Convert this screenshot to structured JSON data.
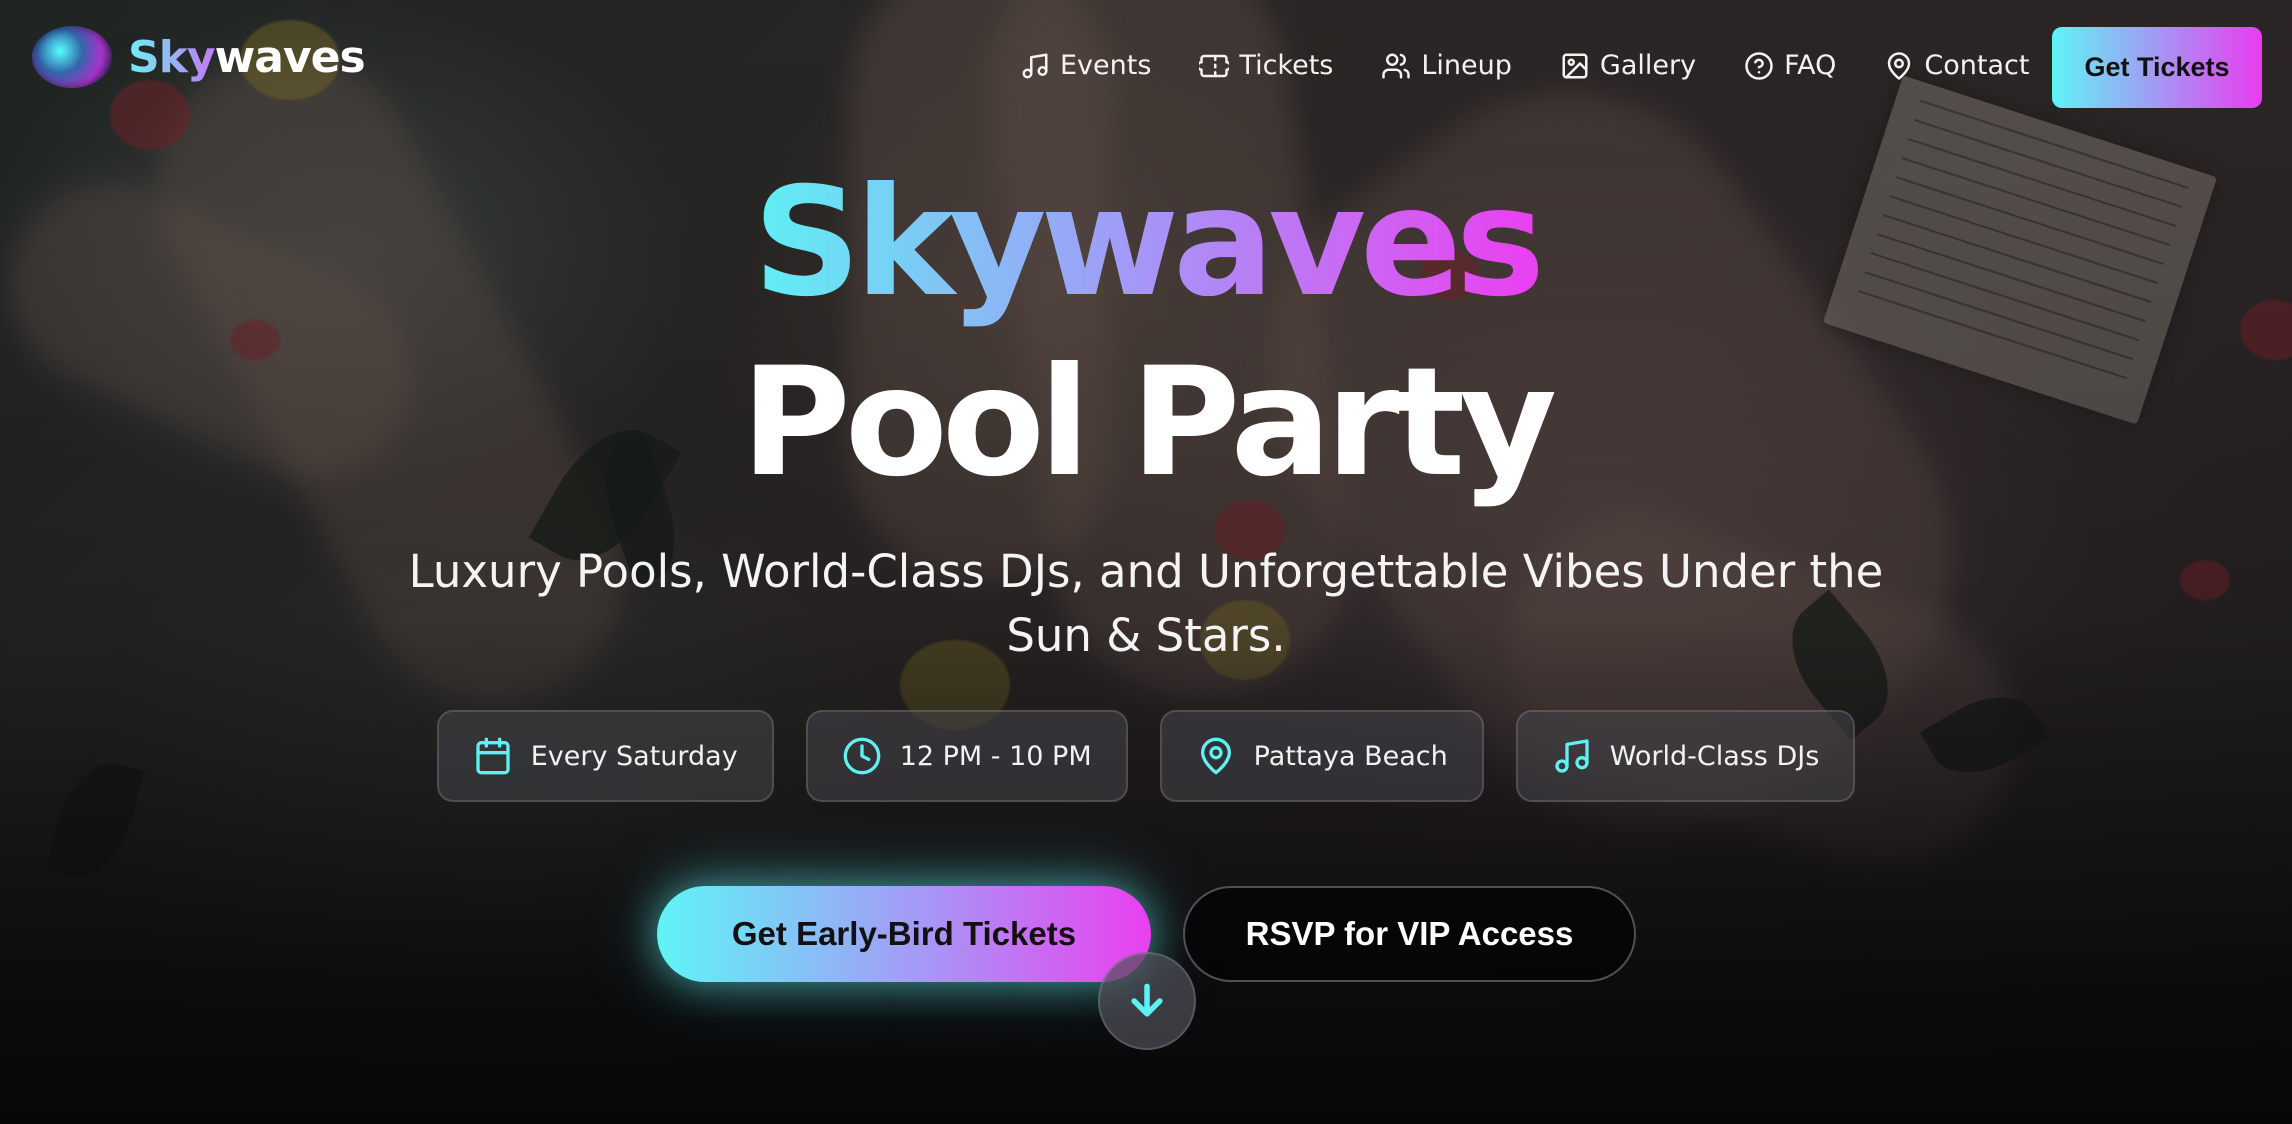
{
  "brand": {
    "name_part1": "Sky",
    "name_part2": "waves",
    "logo_icon": "gradient-orb-logo"
  },
  "nav": {
    "items": [
      {
        "label": "Events",
        "icon": "music-note-icon"
      },
      {
        "label": "Tickets",
        "icon": "ticket-icon"
      },
      {
        "label": "Lineup",
        "icon": "users-icon"
      },
      {
        "label": "Gallery",
        "icon": "image-icon"
      },
      {
        "label": "FAQ",
        "icon": "help-circle-icon"
      },
      {
        "label": "Contact",
        "icon": "map-pin-icon"
      }
    ],
    "cta_label": "Get Tickets"
  },
  "hero": {
    "title_line1": "Skywaves",
    "title_line2": "Pool Party",
    "subtitle": "Luxury Pools, World-Class DJs, and Unforgettable Vibes Under the Sun & Stars.",
    "pills": [
      {
        "label": "Every Saturday",
        "icon": "calendar-icon"
      },
      {
        "label": "12 PM - 10 PM",
        "icon": "clock-icon"
      },
      {
        "label": "Pattaya Beach",
        "icon": "map-pin-icon"
      },
      {
        "label": "World-Class DJs",
        "icon": "music-note-icon"
      }
    ],
    "primary_cta": "Get Early-Bird Tickets",
    "secondary_cta": "RSVP for VIP Access",
    "scroll_icon": "arrow-down-icon"
  },
  "colors": {
    "accent_cyan": "#5ff0f3",
    "accent_magenta": "#ea3ff0",
    "accent_violet": "#a596f7"
  }
}
